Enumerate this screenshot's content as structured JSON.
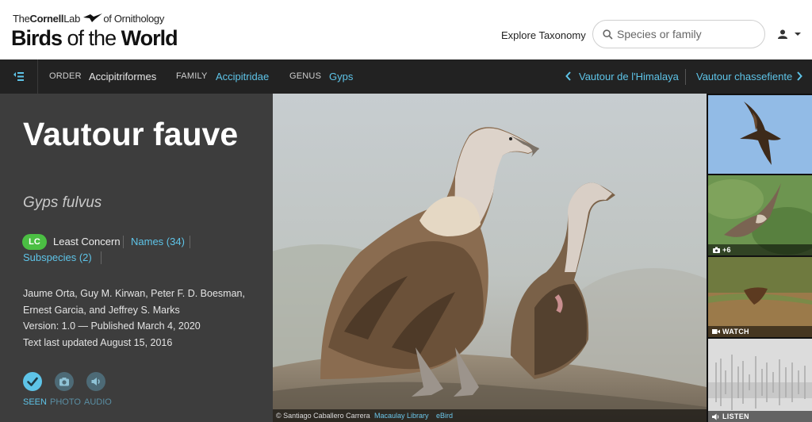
{
  "header": {
    "logo_prefix": "The",
    "logo_brand": "Cornell",
    "logo_lab": "Lab",
    "logo_suffix": "of Ornithology",
    "logo_title_a": "Birds",
    "logo_title_b": " of the ",
    "logo_title_c": "World",
    "explore_label": "Explore Taxonomy",
    "search_placeholder": "Species or family",
    "search_icon": "search-icon",
    "user_icon": "user-icon"
  },
  "nav": {
    "menu_icon": "taxonomy-menu-icon",
    "order_label": "ORDER",
    "order_value": "Accipitriformes",
    "family_label": "FAMILY",
    "family_value": "Accipitridae",
    "genus_label": "GENUS",
    "genus_value": "Gyps",
    "prev_species": "Vautour de l'Himalaya",
    "next_species": "Vautour chassefiente"
  },
  "species": {
    "common_name": "Vautour fauve",
    "scientific_name": "Gyps fulvus",
    "status_code": "LC",
    "status_label": "Least Concern",
    "names_link": "Names (34)",
    "subspecies_link": "Subspecies (2)",
    "authors_line1": "Jaume Orta, Guy M. Kirwan, Peter F. D. Boesman,",
    "authors_line2": "Ernest Garcia, and Jeffrey S. Marks",
    "version": "Version: 1.0 — Published March 4, 2020",
    "updated": "Text last updated August 15, 2016"
  },
  "actions": {
    "seen": "SEEN",
    "photo": "PHOTO",
    "audio": "AUDIO"
  },
  "photo": {
    "credit_author": "© Santiago Caballero Carrera",
    "credit_library": "Macaulay Library",
    "credit_source": "eBird"
  },
  "thumbnails": {
    "photo_count": "+6",
    "watch_label": "WATCH",
    "listen_label": "LISTEN"
  },
  "colors": {
    "accent_blue": "#5ec4e8",
    "nav_bg": "#222222",
    "panel_bg": "#3d3d3d",
    "lc_green": "#4bbf43"
  }
}
